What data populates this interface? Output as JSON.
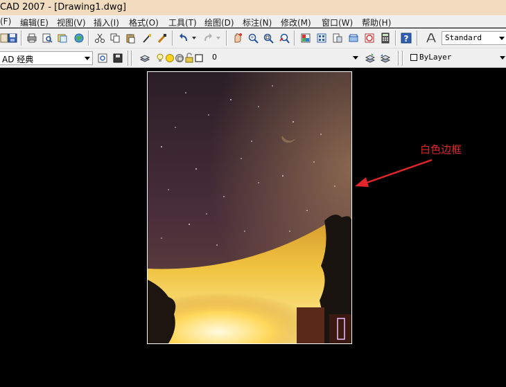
{
  "window": {
    "title": "CAD 2007 - [Drawing1.dwg]"
  },
  "menubar": {
    "items": [
      "(F)",
      "编辑(E)",
      "视图(V)",
      "插入(I)",
      "格式(O)",
      "工具(T)",
      "绘图(D)",
      "标注(N)",
      "修改(M)",
      "窗口(W)",
      "帮助(H)"
    ]
  },
  "toolbar": {
    "text_style": "Standard",
    "workspace": "AD 经典",
    "layer": "0",
    "color": "ByLayer"
  },
  "annotation": {
    "text": "白色边框"
  },
  "colors": {
    "annotation": "#e0262a",
    "frame_border": "#ffffff",
    "canvas_bg": "#000000"
  }
}
